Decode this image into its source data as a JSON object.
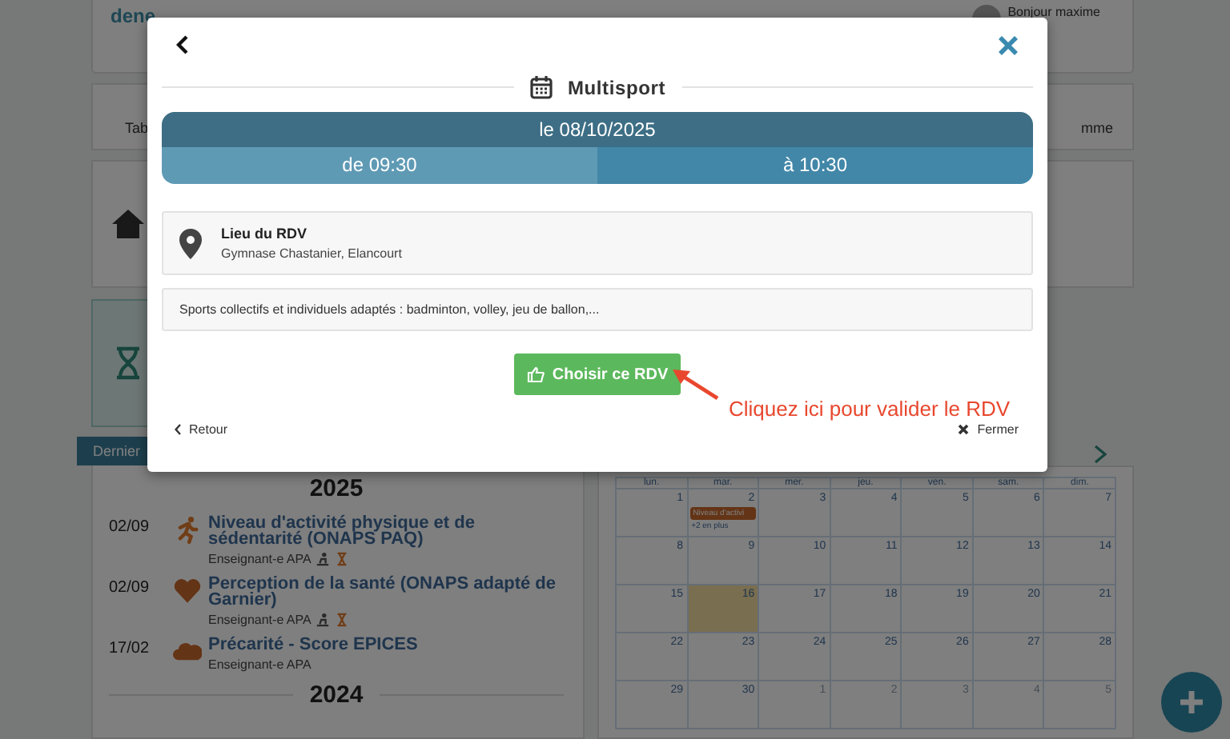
{
  "header": {
    "logo": "dene",
    "greeting": "Bonjour maxime"
  },
  "tile_labels": [
    "Tab",
    "mme"
  ],
  "recent": {
    "tab": "Dernier",
    "groups": [
      {
        "year": "2025",
        "items": [
          {
            "date": "02/09",
            "kind": "run",
            "title": "Niveau d'activité physique et de sédentarité (ONAPS PAQ)",
            "role": "Enseignant-e APA",
            "badges": [
              {
                "kind": "person"
              },
              {
                "kind": "hourglass"
              }
            ]
          },
          {
            "date": "02/09",
            "kind": "heart",
            "title": "Perception de la santé (ONAPS adapté de Garnier)",
            "role": "Enseignant-e APA",
            "badges": [
              {
                "kind": "person"
              },
              {
                "kind": "hourglass"
              }
            ]
          },
          {
            "date": "17/02",
            "kind": "cloud",
            "title": "Précarité - Score EPICES",
            "role": "Enseignant-e APA"
          }
        ]
      },
      {
        "year": "2024"
      }
    ]
  },
  "calendar": {
    "weekdays": [
      "lun.",
      "mar.",
      "mer.",
      "jeu.",
      "ven.",
      "sam.",
      "dim."
    ],
    "weeks": [
      [
        {
          "day": "1",
          "other_month": false,
          "today": false
        },
        {
          "day": "2",
          "other_month": false,
          "today": false,
          "event": "Niveau d'activi",
          "more": "+2 en plus"
        },
        {
          "day": "3",
          "other_month": false,
          "today": false
        },
        {
          "day": "4",
          "other_month": false,
          "today": false
        },
        {
          "day": "5",
          "other_month": false,
          "today": false
        },
        {
          "day": "6",
          "other_month": false,
          "today": false
        },
        {
          "day": "7",
          "other_month": false,
          "today": false
        }
      ],
      [
        {
          "day": "8",
          "other_month": false,
          "today": false
        },
        {
          "day": "9",
          "other_month": false,
          "today": false
        },
        {
          "day": "10",
          "other_month": false,
          "today": false
        },
        {
          "day": "11",
          "other_month": false,
          "today": false
        },
        {
          "day": "12",
          "other_month": false,
          "today": false
        },
        {
          "day": "13",
          "other_month": false,
          "today": false
        },
        {
          "day": "14",
          "other_month": false,
          "today": false
        }
      ],
      [
        {
          "day": "15",
          "other_month": false,
          "today": false
        },
        {
          "day": "16",
          "other_month": false,
          "today": true
        },
        {
          "day": "17",
          "other_month": false,
          "today": false
        },
        {
          "day": "18",
          "other_month": false,
          "today": false
        },
        {
          "day": "19",
          "other_month": false,
          "today": false
        },
        {
          "day": "20",
          "other_month": false,
          "today": false
        },
        {
          "day": "21",
          "other_month": false,
          "today": false
        }
      ],
      [
        {
          "day": "22",
          "other_month": false,
          "today": false
        },
        {
          "day": "23",
          "other_month": false,
          "today": false
        },
        {
          "day": "24",
          "other_month": false,
          "today": false
        },
        {
          "day": "25",
          "other_month": false,
          "today": false
        },
        {
          "day": "26",
          "other_month": false,
          "today": false
        },
        {
          "day": "27",
          "other_month": false,
          "today": false
        },
        {
          "day": "28",
          "other_month": false,
          "today": false
        }
      ],
      [
        {
          "day": "29",
          "other_month": false,
          "today": false
        },
        {
          "day": "30",
          "other_month": false,
          "today": false
        },
        {
          "day": "1",
          "other_month": true,
          "today": false
        },
        {
          "day": "2",
          "other_month": true,
          "today": false
        },
        {
          "day": "3",
          "other_month": true,
          "today": false
        },
        {
          "day": "4",
          "other_month": true,
          "today": false
        },
        {
          "day": "5",
          "other_month": true,
          "today": false
        }
      ]
    ]
  },
  "modal": {
    "title": "Multisport",
    "date": "le 08/10/2025",
    "start": "de 09:30",
    "end": "à 10:30",
    "location_label": "Lieu du RDV",
    "location": "Gymnase Chastanier, Elancourt",
    "description": "Sports collectifs et individuels adaptés : badminton, volley, jeu de ballon,...",
    "choose_button": "Choisir ce RDV",
    "back": "Retour",
    "close": "Fermer"
  },
  "annotation": {
    "text": "Cliquez ici pour valider le RDV"
  }
}
